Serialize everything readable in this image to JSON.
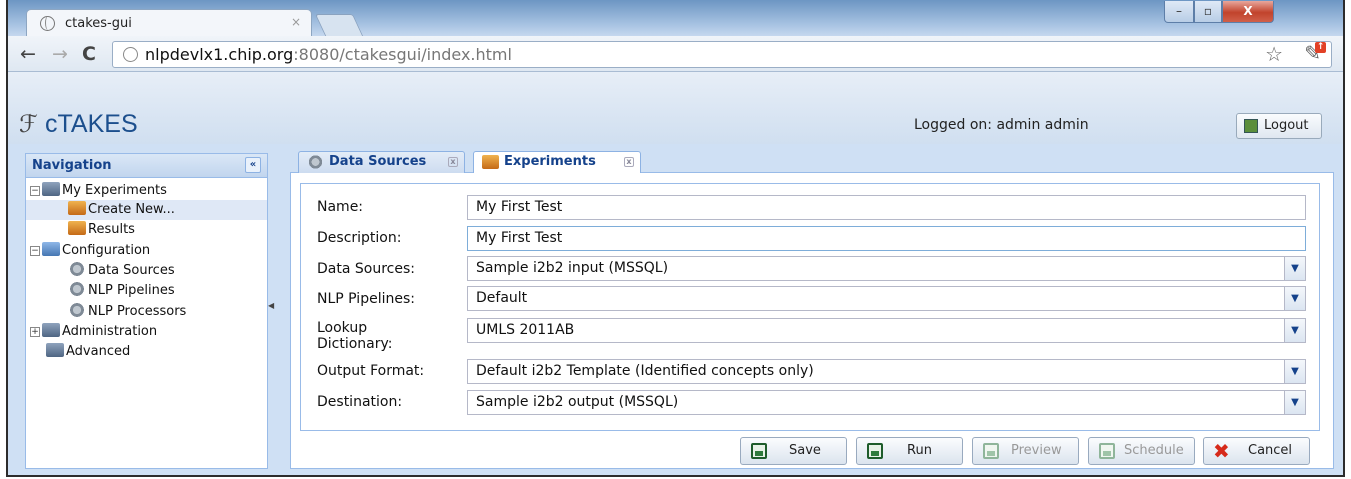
{
  "browser": {
    "tab_title": "ctakes-gui",
    "tab_close": "×",
    "url_host": "nlpdevlx1.chip.org",
    "url_path": ":8080/ctakesgui/index.html",
    "window_min": "–",
    "window_max": "▫",
    "window_close": "X",
    "back": "←",
    "forward": "→",
    "reload": "C",
    "star": "☆"
  },
  "app": {
    "logo": "cTAKES",
    "logged_on": "Logged on: admin admin",
    "logout": "Logout"
  },
  "nav": {
    "title": "Navigation",
    "collapse": "«",
    "items": [
      {
        "label": "My Experiments",
        "icon": "computer-folder-icon",
        "toggle": "−"
      },
      {
        "label": "Create New...",
        "icon": "people-icon"
      },
      {
        "label": "Results",
        "icon": "people-icon"
      },
      {
        "label": "Configuration",
        "icon": "configuration-icon",
        "toggle": "−"
      },
      {
        "label": "Data Sources",
        "icon": "gear-icon"
      },
      {
        "label": "NLP Pipelines",
        "icon": "gear-icon"
      },
      {
        "label": "NLP Processors",
        "icon": "gear-icon"
      },
      {
        "label": "Administration",
        "icon": "computer-folder-icon",
        "toggle": "+"
      },
      {
        "label": "Advanced",
        "icon": "computer-folder-icon"
      }
    ]
  },
  "tabs": [
    {
      "label": "Data Sources"
    },
    {
      "label": "Experiments"
    }
  ],
  "form": {
    "name_label": "Name:",
    "name_value": "My First Test",
    "description_label": "Description:",
    "description_value": "My First Test",
    "data_sources_label": "Data Sources:",
    "data_sources_value": "Sample i2b2 input (MSSQL)",
    "pipelines_label": "NLP Pipelines:",
    "pipelines_value": "Default",
    "lookup_label_1": "Lookup",
    "lookup_label_2": "Dictionary:",
    "lookup_value": "UMLS 2011AB",
    "output_label": "Output Format:",
    "output_value": "Default i2b2 Template (Identified concepts only)",
    "destination_label": "Destination:",
    "destination_value": "Sample i2b2 output (MSSQL)"
  },
  "buttons": {
    "save": "Save",
    "run": "Run",
    "preview": "Preview",
    "schedule": "Schedule",
    "cancel": "Cancel"
  }
}
